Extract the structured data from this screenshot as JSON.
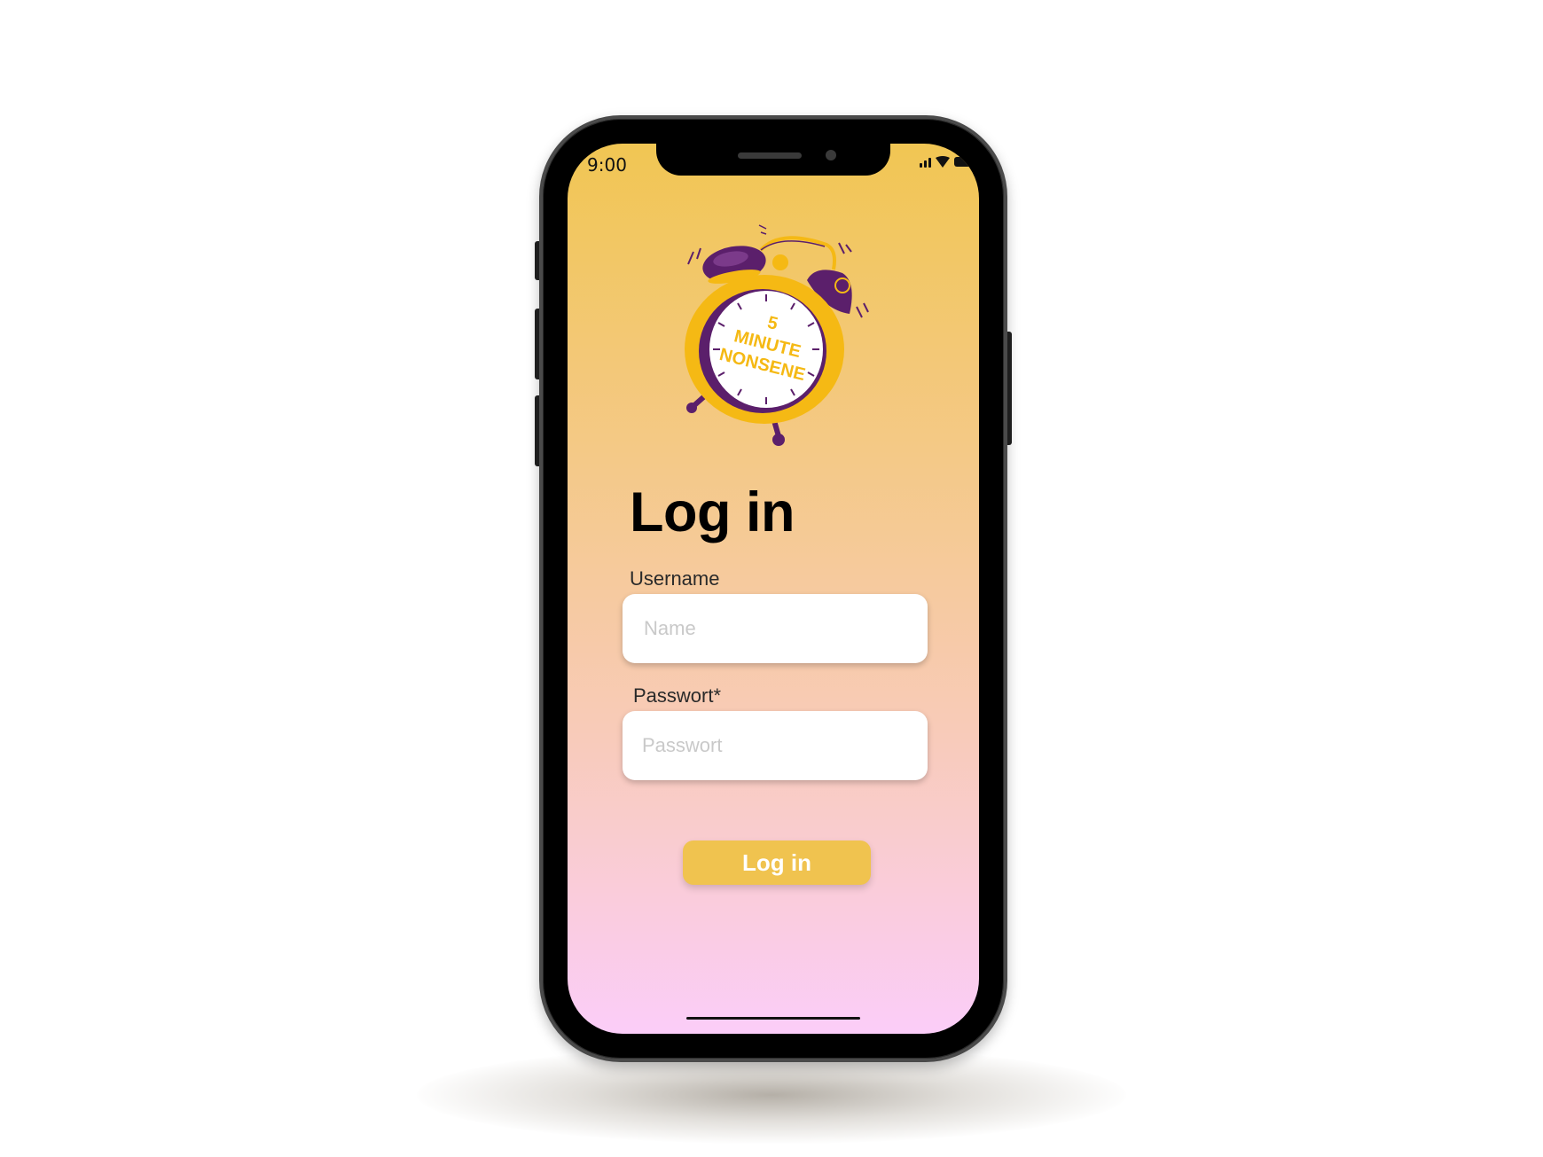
{
  "status_bar": {
    "time": "9:00",
    "icons": [
      "signal-icon",
      "wifi-icon",
      "battery-icon"
    ]
  },
  "logo": {
    "line1": "5",
    "line2": "MINUTE",
    "line3": "NONSENE",
    "icon": "alarm-clock-icon",
    "colors": {
      "yellow": "#F5B914",
      "purple": "#5B1F6B",
      "face": "#FFFFFF"
    }
  },
  "login": {
    "title": "Log in",
    "username_label": "Username",
    "username_placeholder": "Name",
    "password_label": "Passwort*",
    "password_placeholder": "Passwort",
    "submit_label": "Log in"
  },
  "colors": {
    "gradient_top": "#F1C653",
    "gradient_bottom": "#FBCDF8",
    "button": "#F0C34F"
  }
}
